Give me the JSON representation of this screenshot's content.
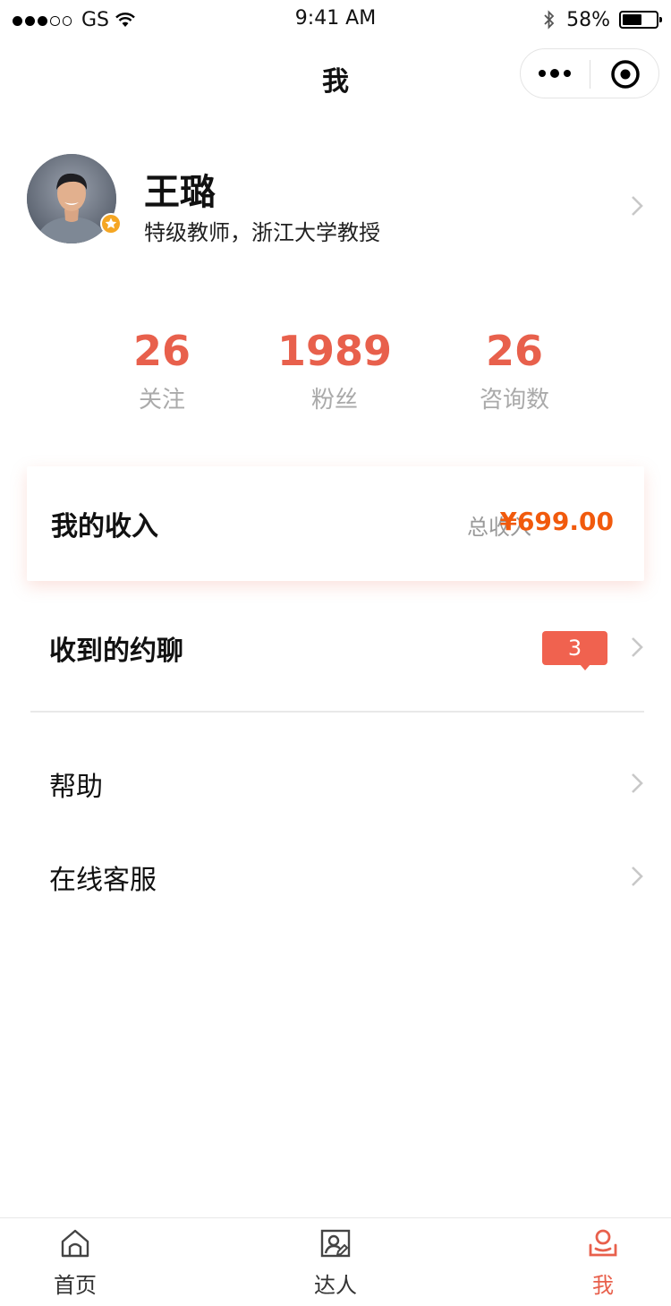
{
  "status_bar": {
    "carrier": "GS",
    "time": "9:41 AM",
    "battery": "58%",
    "battery_level": 0.58
  },
  "nav": {
    "title": "我"
  },
  "profile": {
    "name": "王璐",
    "title": "特级教师，浙江大学教授"
  },
  "stats": [
    {
      "value": "26",
      "label": "关注"
    },
    {
      "value": "1989",
      "label": "粉丝"
    },
    {
      "value": "26",
      "label": "咨询数"
    }
  ],
  "income": {
    "title": "我的收入",
    "total_label": "总收入",
    "total_value": "¥699.00"
  },
  "menu": {
    "invites": {
      "label": "收到的约聊",
      "badge": "3"
    },
    "help": {
      "label": "帮助"
    },
    "service": {
      "label": "在线客服"
    }
  },
  "tabbar": {
    "items": [
      {
        "label": "首页",
        "icon": "home-icon"
      },
      {
        "label": "达人",
        "icon": "expert-icon"
      },
      {
        "label": "我",
        "icon": "user-icon"
      }
    ]
  },
  "colors": {
    "accent": "#e8604c",
    "price": "#f15a0d",
    "badge": "#f0624f",
    "muted": "#aaaaaa"
  }
}
